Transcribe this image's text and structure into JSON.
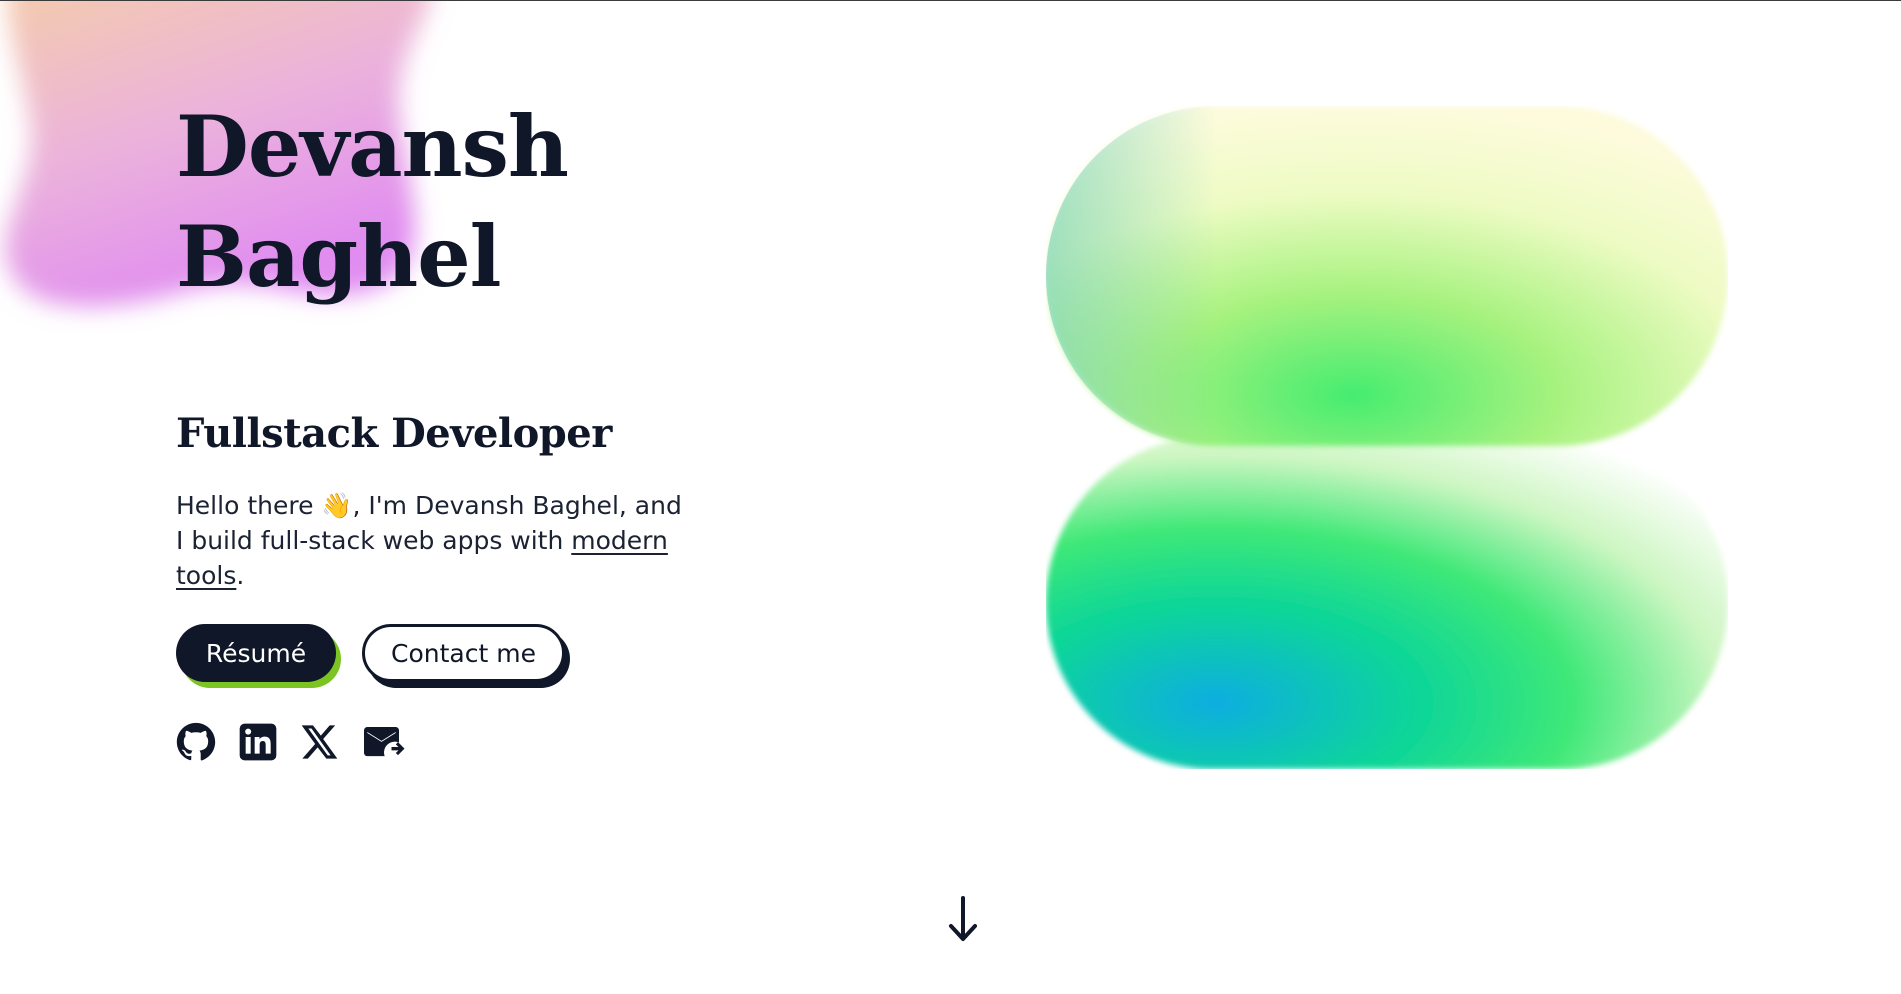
{
  "hero": {
    "name_line1": "Devansh",
    "name_line2": "Baghel",
    "role": "Fullstack Developer",
    "intro_before": "Hello there 👋, I'm Devansh Baghel, and I build full-stack web apps with ",
    "intro_link": "modern tools",
    "intro_after": "."
  },
  "buttons": {
    "resume_label": "Résumé",
    "contact_label": "Contact me"
  },
  "socials": [
    {
      "name": "GitHub",
      "icon": "github-icon"
    },
    {
      "name": "LinkedIn",
      "icon": "linkedin-icon"
    },
    {
      "name": "X",
      "icon": "x-icon"
    },
    {
      "name": "Email",
      "icon": "mail-forward-icon"
    }
  ],
  "colors": {
    "ink": "#0f1729",
    "resume_shadow": "#7cc422",
    "blob_top": "#f6c8a8",
    "blob_bottom": "#e39bf0",
    "gradient_green": "#3fe86f",
    "gradient_blue": "#0aa7e6",
    "gradient_cream": "#fdfbd8"
  },
  "scroll": {
    "icon": "arrow-down-icon"
  }
}
